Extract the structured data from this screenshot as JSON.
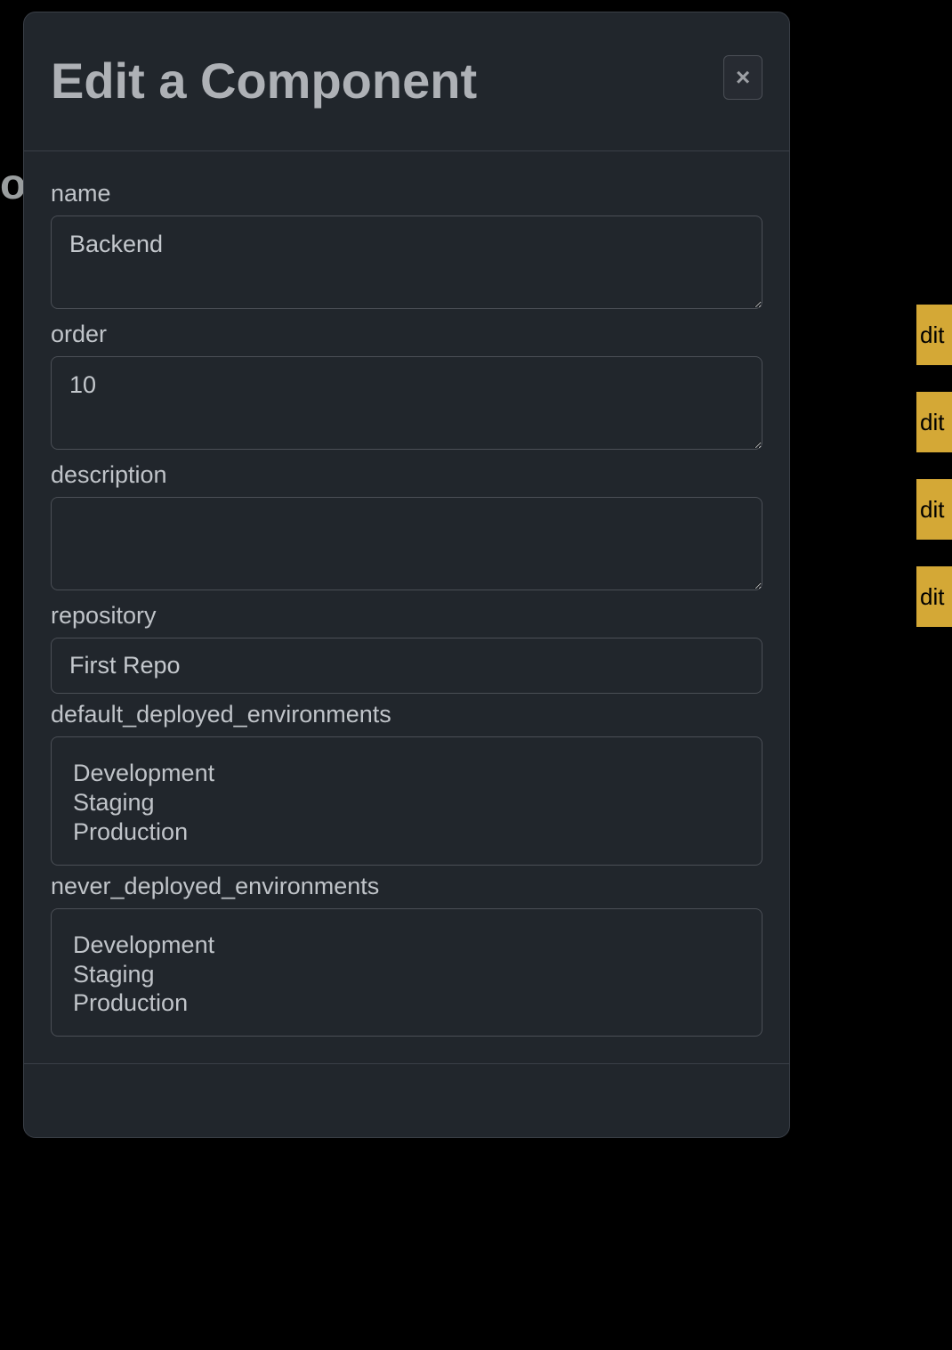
{
  "background": {
    "partial_heading": "oc",
    "edit_buttons": [
      "dit",
      "dit",
      "dit",
      "dit"
    ]
  },
  "modal": {
    "title": "Edit a Component",
    "close_symbol": "×",
    "fields": {
      "name": {
        "label": "name",
        "value": "Backend"
      },
      "order": {
        "label": "order",
        "value": "10"
      },
      "description": {
        "label": "description",
        "value": ""
      },
      "repository": {
        "label": "repository",
        "value": "First Repo"
      },
      "default_deployed_environments": {
        "label": "default_deployed_environments",
        "options": [
          "Development",
          "Staging",
          "Production"
        ]
      },
      "never_deployed_environments": {
        "label": "never_deployed_environments",
        "options": [
          "Development",
          "Staging",
          "Production"
        ]
      }
    }
  }
}
